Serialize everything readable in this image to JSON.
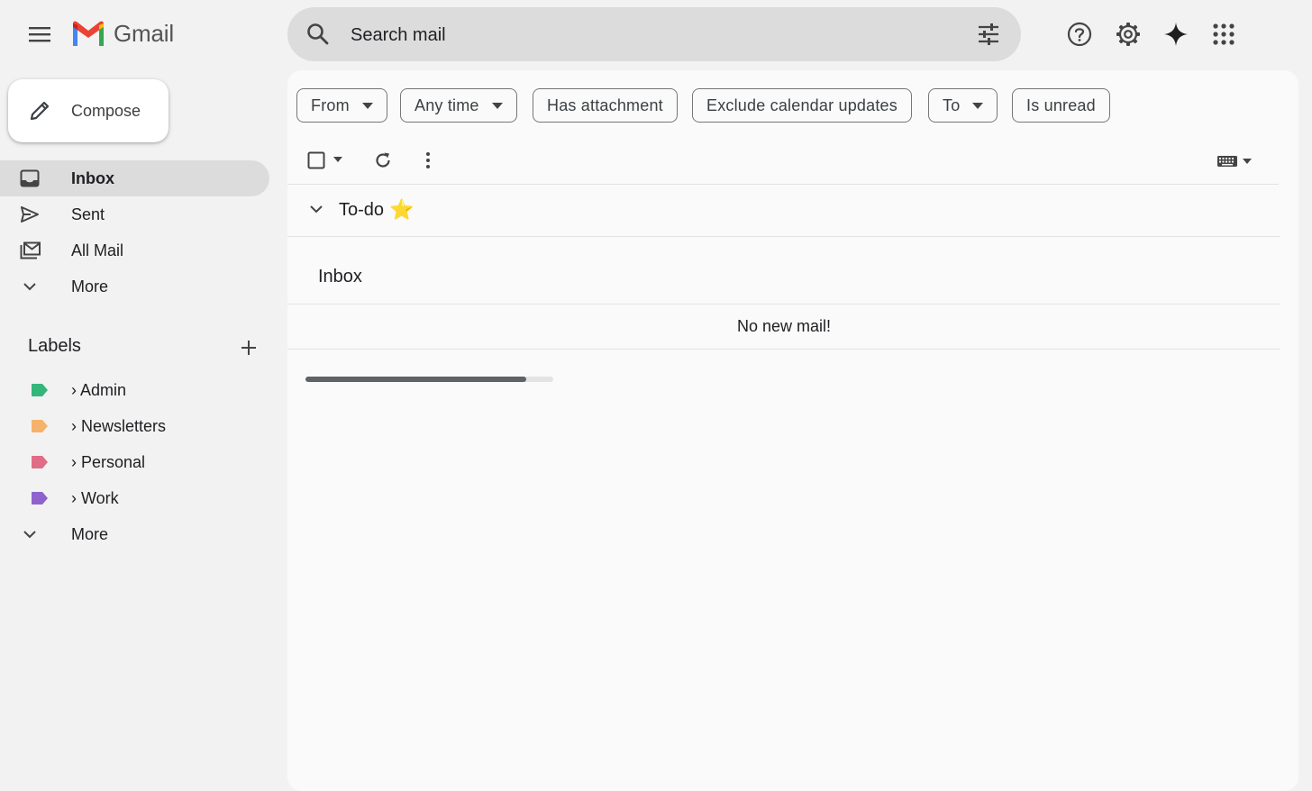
{
  "app": {
    "name": "Gmail"
  },
  "search": {
    "placeholder": "Search mail"
  },
  "compose": {
    "label": "Compose"
  },
  "nav": [
    {
      "label": "Inbox",
      "icon": "inbox-icon",
      "active": true
    },
    {
      "label": "Sent",
      "icon": "send-icon",
      "active": false
    },
    {
      "label": "All Mail",
      "icon": "all-mail-icon",
      "active": false
    },
    {
      "label": "More",
      "icon": "chevron-down-icon",
      "active": false
    }
  ],
  "labels": {
    "title": "Labels",
    "items": [
      {
        "label": "› Admin",
        "color": "#33b679"
      },
      {
        "label": "› Newsletters",
        "color": "#f6b26b"
      },
      {
        "label": "› Personal",
        "color": "#e06c86"
      },
      {
        "label": "› Work",
        "color": "#8e63ce"
      }
    ],
    "more_label": "More"
  },
  "filters": [
    {
      "label": "From",
      "dropdown": true
    },
    {
      "label": "Any time",
      "dropdown": true
    },
    {
      "label": "Has attachment",
      "dropdown": false
    },
    {
      "label": "Exclude calendar updates",
      "dropdown": false
    },
    {
      "label": "To",
      "dropdown": true
    },
    {
      "label": "Is unread",
      "dropdown": false
    }
  ],
  "sections": {
    "todo_title": "To-do",
    "todo_star": "⭐",
    "inbox_title": "Inbox",
    "empty_message": "No new mail!"
  },
  "loading": {
    "progress": 0.89
  },
  "colors": {
    "active_nav": "#dcdcdc",
    "search_bg": "#dcdcdc",
    "gmail_red": "#ea4335",
    "gmail_blue": "#4285f4",
    "gmail_green": "#34a853",
    "gmail_yellow": "#fbbc04"
  }
}
